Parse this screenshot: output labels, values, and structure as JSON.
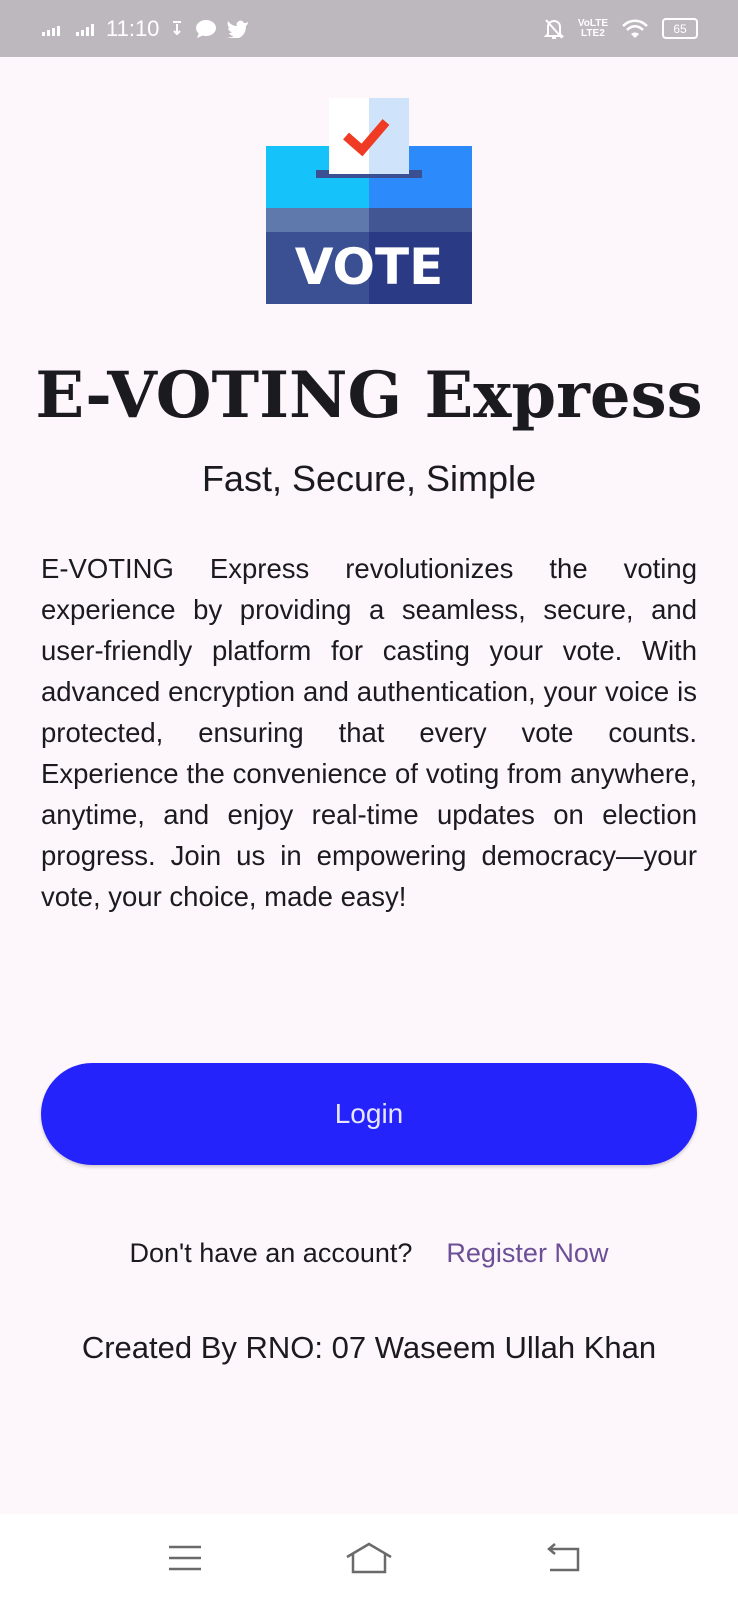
{
  "status_bar": {
    "time": "11:10",
    "network_type": "LTE2",
    "carrier_label": "VoLTE",
    "battery_level": "65"
  },
  "app": {
    "logo_label": "VOTE",
    "title": "E-VOTING Express",
    "subtitle": "Fast, Secure, Simple",
    "description": "E-VOTING Express revolutionizes the voting experience by providing a seamless, secure, and user-friendly platform for casting your vote. With advanced encryption and authentication, your voice is protected, ensuring that every vote counts. Experience the convenience of voting from anywhere, anytime, and enjoy real-time updates on election progress. Join us in empowering democracy—your vote, your choice, made easy!",
    "login_label": "Login",
    "register_prompt": "Don't have an account?",
    "register_link": "Register Now",
    "credit": "Created By RNO: 07 Waseem Ullah Khan"
  },
  "icons": {
    "status_left": [
      "signal-icon",
      "signal-icon",
      "download-icon",
      "message-icon",
      "twitter-icon"
    ],
    "status_right": [
      "mute-icon",
      "volte-icon",
      "wifi-icon",
      "battery-icon"
    ],
    "nav": [
      "menu-icon",
      "home-icon",
      "back-icon"
    ]
  },
  "colors": {
    "background": "#fdf6fb",
    "status_bar": "#bdb8bd",
    "login_button": "#2523fb",
    "register_link": "#6c4f96",
    "logo_light_blue": "#16c2fa",
    "logo_blue": "#2d8afa",
    "logo_navy": "#2b3a84",
    "check_red": "#ef3b24"
  }
}
